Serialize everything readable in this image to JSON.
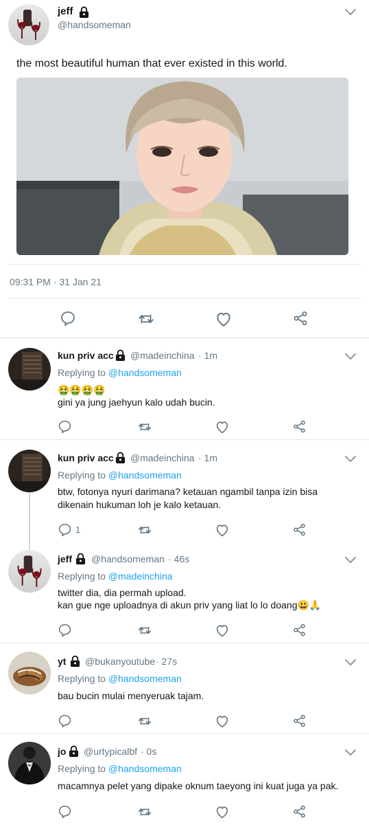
{
  "main_tweet": {
    "name": "jeff",
    "handle": "@handsomeman",
    "text": "the most beautiful human that ever existed in this world.",
    "timestamp": "09:31 PM · 31 Jan 21"
  },
  "replies": [
    {
      "name": "kun priv acc",
      "handle": "@madeinchina",
      "time": "· 1m",
      "replying_label": "Replying to",
      "replying_to": "@handsomeman",
      "emoji": "🤮🤮🤮🤮",
      "text": "gini ya jung jaehyun kalo udah bucin.",
      "reply_count": ""
    },
    {
      "name": "kun priv acc",
      "handle": "@madeinchina",
      "time": "· 1m",
      "replying_label": "Replying to",
      "replying_to": "@handsomeman",
      "text": "btw, fotonya nyuri darimana? ketauan ngambil tanpa izin bisa dikenain hukuman loh je kalo ketauan.",
      "reply_count": "1"
    },
    {
      "name": "jeff",
      "handle": "@handsomeman",
      "time": "· 46s",
      "replying_label": "Replying to",
      "replying_to": "@madeinchina",
      "text_line1": "twitter dia, dia permah upload.",
      "text_line2": "kan gue nge uploadnya di akun priv yang liat lo lo doang😃🙏",
      "reply_count": ""
    },
    {
      "name": "yt",
      "handle": "@bukanyoutube",
      "time": "· 27s",
      "replying_label": "Replying to",
      "replying_to": "@handsomeman",
      "text": "bau bucin mulai menyeruak tajam.",
      "reply_count": ""
    },
    {
      "name": "jo",
      "handle": "@urtypicalbf",
      "time": "· 0s",
      "replying_label": "Replying to",
      "replying_to": "@handsomeman",
      "text": "macamnya pelet yang dipake oknum taeyong ini kuat juga ya pak.",
      "reply_count": ""
    }
  ],
  "icons": {
    "reply": "reply-icon",
    "retweet": "retweet-icon",
    "like": "heart-icon",
    "share": "share-icon",
    "lock": "lock-icon",
    "chevron": "chevron-down-icon"
  },
  "colors": {
    "link": "#1da1f2",
    "secondary": "#657786",
    "divider": "#e1e8ed",
    "icon": "#657786"
  }
}
